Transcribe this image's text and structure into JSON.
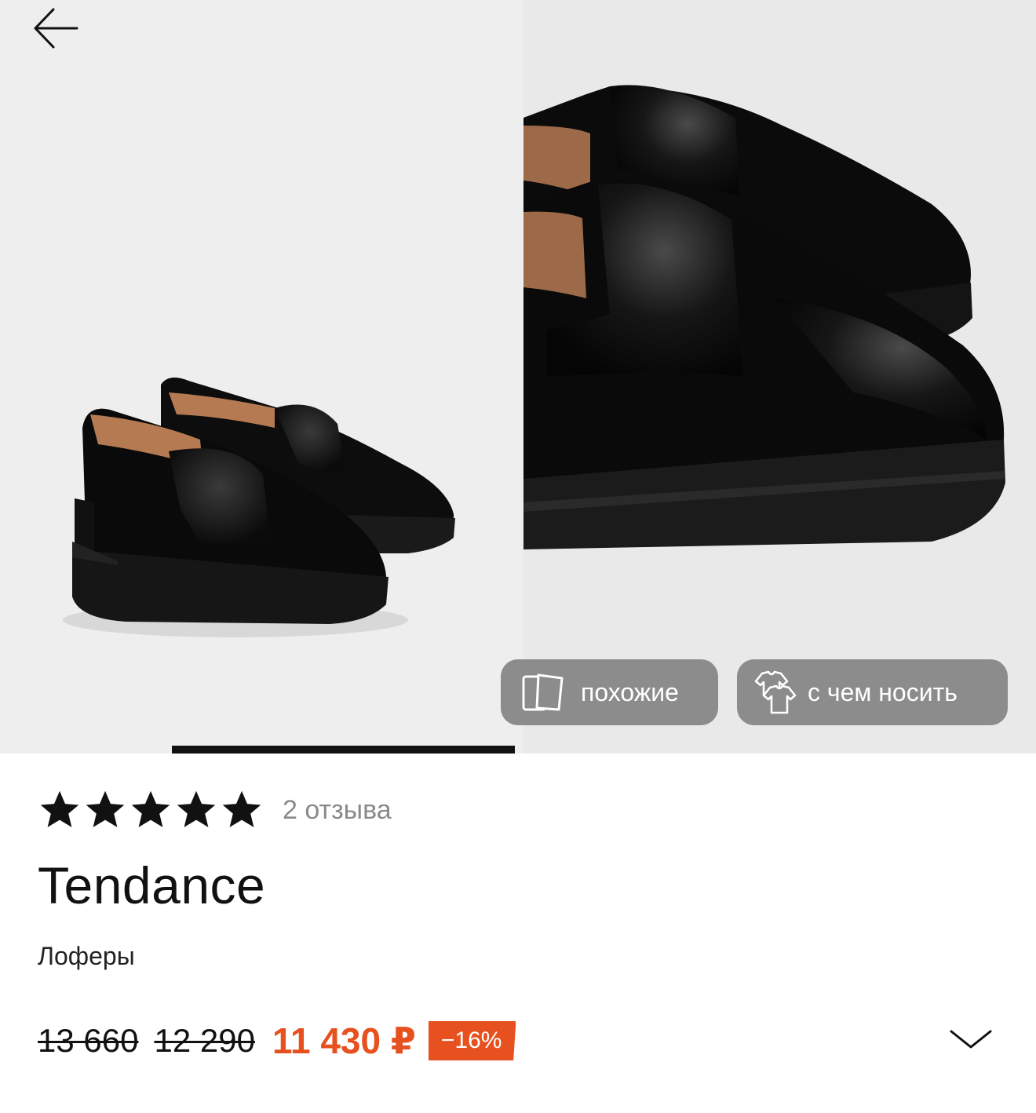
{
  "gallery": {
    "images": [
      "loafers-pair-photo",
      "loafers-closeup-photo"
    ],
    "similar_label": "похожие",
    "wear_with_label": "с чем носить",
    "icons": {
      "back": "arrow-left-icon",
      "similar": "cards-icon",
      "wear_with": "shirts-icon"
    }
  },
  "product": {
    "rating_stars": 5,
    "reviews_label": "2 отзыва",
    "brand": "Tendance",
    "category": "Лоферы",
    "old_price_1": "13 660",
    "old_price_2": "12 290",
    "price": "11 430 ₽",
    "discount": "−16%"
  },
  "colors": {
    "accent": "#e7501f",
    "pill_bg": "#8c8c8c",
    "gallery_bg": "#eeeeee"
  }
}
